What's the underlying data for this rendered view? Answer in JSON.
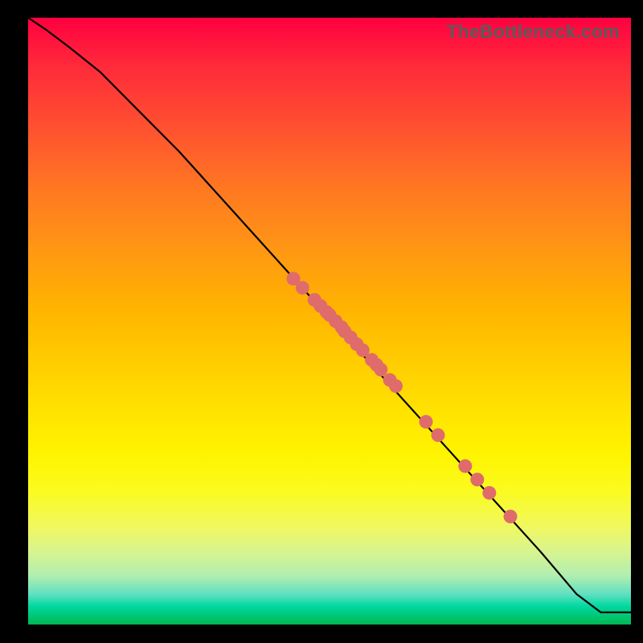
{
  "watermark": "TheBottleneck.com",
  "chart_data": {
    "type": "line",
    "title": "",
    "xlabel": "",
    "ylabel": "",
    "xlim": [
      0,
      100
    ],
    "ylim": [
      0,
      100
    ],
    "grid": false,
    "legend": false,
    "series": [
      {
        "name": "curve",
        "kind": "line",
        "x": [
          0,
          3,
          7,
          12,
          18,
          25,
          35,
          45,
          55,
          65,
          75,
          85,
          91,
          95,
          100
        ],
        "y": [
          100,
          98,
          95,
          91,
          85,
          78,
          67,
          56,
          45,
          34,
          23,
          12,
          5,
          2,
          2
        ]
      },
      {
        "name": "marked-points",
        "kind": "scatter",
        "x": [
          44,
          45.5,
          47.5,
          48.5,
          49.5,
          50,
          51,
          52,
          52.5,
          53.5,
          54.5,
          55.5,
          57,
          57.8,
          58.5,
          60,
          61,
          66,
          68,
          72.5,
          74.5,
          76.5,
          80
        ],
        "y": [
          57,
          55.5,
          53.5,
          52.5,
          51.5,
          51,
          50,
          49,
          48.3,
          47.3,
          46.2,
          45.2,
          43.6,
          42.8,
          42,
          40.3,
          39.3,
          33.4,
          31.2,
          26.1,
          23.9,
          21.7,
          17.8
        ]
      }
    ],
    "background_gradient": {
      "top": "#ff0040",
      "mid": "#ffe600",
      "bottom": "#00b850"
    }
  }
}
